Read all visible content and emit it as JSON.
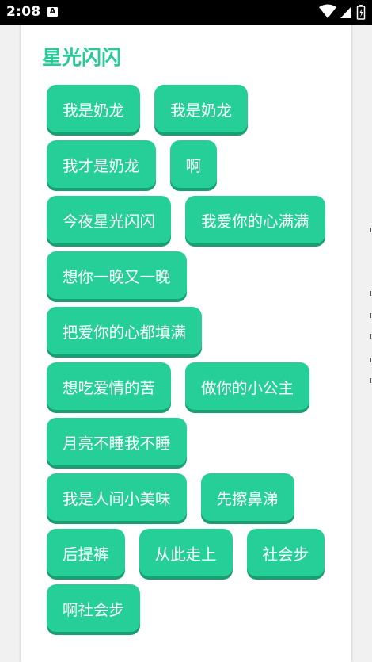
{
  "status_bar": {
    "time": "2:08",
    "notification_badge": "A",
    "icons": [
      "wifi-icon",
      "signal-icon",
      "battery-icon"
    ]
  },
  "page": {
    "title": "星光闪闪",
    "accent_color": "#26cc97"
  },
  "tags": [
    "我是奶龙",
    "我是奶龙",
    "我才是奶龙",
    "啊",
    "今夜星光闪闪",
    "我爱你的心满满",
    "想你一晚又一晚",
    "把爱你的心都填满",
    "想吃爱情的苦",
    "做你的小公主",
    "月亮不睡我不睡",
    "我是人间小美味",
    "先擦鼻涕",
    "后提裤",
    "从此走上",
    "社会步",
    "啊社会步"
  ]
}
